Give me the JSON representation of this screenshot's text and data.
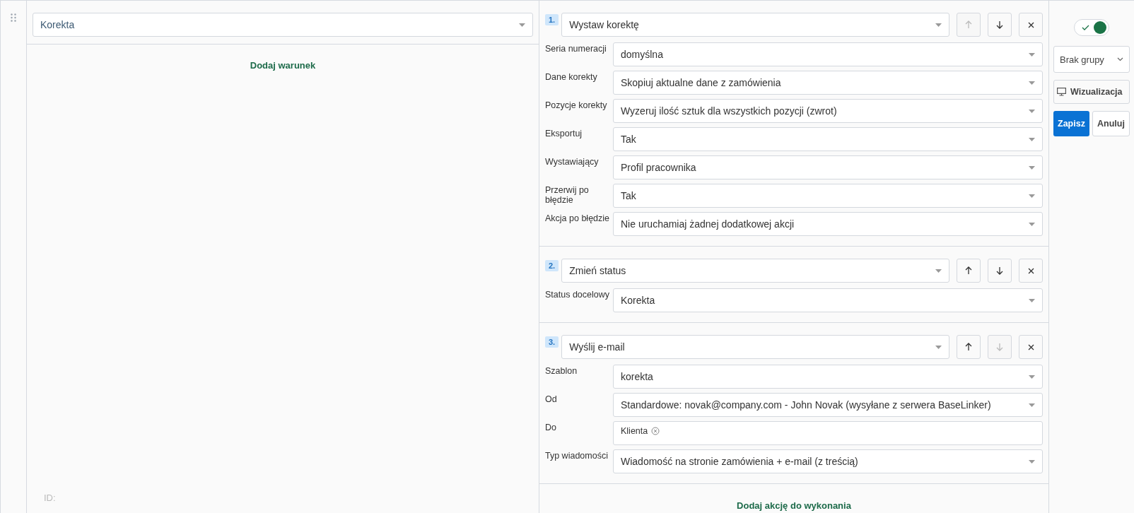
{
  "trigger": {
    "value": "Korekta"
  },
  "add_condition": "Dodaj warunek",
  "id_label": "ID:",
  "actions": [
    {
      "number": "1.",
      "type": "Wystaw korektę",
      "can_move_up": false,
      "can_move_down": true,
      "fields": [
        {
          "label": "Seria numeracji",
          "kind": "select",
          "value": "domyślna"
        },
        {
          "label": "Dane korekty",
          "kind": "select",
          "value": "Skopiuj aktualne dane z zamówienia"
        },
        {
          "label": "Pozycje korekty",
          "kind": "select",
          "value": "Wyzeruj ilość sztuk dla wszystkich pozycji (zwrot)"
        },
        {
          "label": "Eksportuj",
          "kind": "select",
          "value": "Tak"
        },
        {
          "label": "Wystawiający",
          "kind": "select",
          "value": "Profil pracownika"
        },
        {
          "label": "Przerwij po błędzie",
          "kind": "select",
          "value": "Tak"
        },
        {
          "label": "Akcja po błędzie",
          "kind": "select",
          "value": "Nie uruchamiaj żadnej dodatkowej akcji"
        }
      ]
    },
    {
      "number": "2.",
      "type": "Zmień status",
      "can_move_up": true,
      "can_move_down": true,
      "fields": [
        {
          "label": "Status docelowy",
          "kind": "select",
          "value": "Korekta"
        }
      ]
    },
    {
      "number": "3.",
      "type": "Wyślij e-mail",
      "can_move_up": true,
      "can_move_down": false,
      "fields": [
        {
          "label": "Szablon",
          "kind": "select",
          "value": "korekta"
        },
        {
          "label": "Od",
          "kind": "select",
          "value": "Standardowe: novak@company.com - John Novak (wysyłane z serwera BaseLinker)"
        },
        {
          "label": "Do",
          "kind": "tags",
          "tags": [
            "Klienta"
          ]
        },
        {
          "label": "Typ wiadomości",
          "kind": "select",
          "value": "Wiadomość na stronie zamówienia + e-mail (z treścią)"
        }
      ]
    }
  ],
  "add_action": "Dodaj akcję do wykonania",
  "enabled": true,
  "group": "Brak grupy",
  "visualize_button": "Wizualizacja",
  "save_button": "Zapisz",
  "cancel_button": "Anuluj"
}
